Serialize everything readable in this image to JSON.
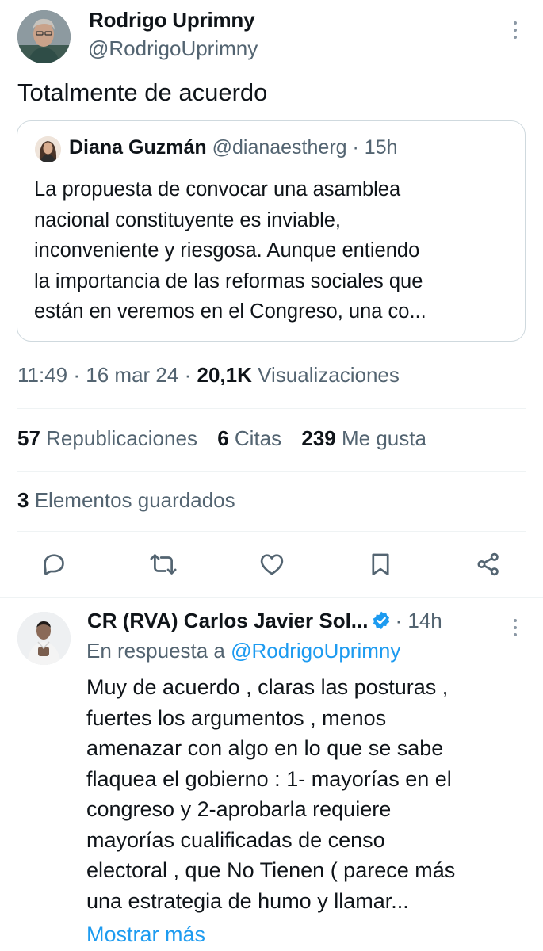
{
  "main_tweet": {
    "author_name": "Rodrigo Uprimny",
    "author_handle": "@RodrigoUprimny",
    "text": "Totalmente de acuerdo",
    "quote": {
      "author_name": "Diana Guzmán",
      "author_handle": "@dianaestherg",
      "separator": "·",
      "age": "15h",
      "lines": [
        "La propuesta de convocar una asamblea",
        "nacional constituyente es inviable,",
        "inconveniente y riesgosa. Aunque entiendo",
        "la importancia de las reformas sociales que",
        "están en veremos en el Congreso, una co..."
      ]
    },
    "meta": {
      "time": "11:49",
      "date": "16 mar 24",
      "separator": "·",
      "views_count": "20,1K",
      "views_label": "Visualizaciones"
    },
    "stats": {
      "reposts_count": "57",
      "reposts_label": "Republicaciones",
      "quotes_count": "6",
      "quotes_label": "Citas",
      "likes_count": "239",
      "likes_label": "Me gusta",
      "bookmarks_count": "3",
      "bookmarks_label": "Elementos guardados"
    },
    "actions": [
      "reply-icon",
      "repost-icon",
      "like-icon",
      "bookmark-icon",
      "share-icon"
    ]
  },
  "reply": {
    "author_name": "CR (RVA) Carlos Javier Sol...",
    "separator": "·",
    "age": "14h",
    "reply_prefix": "En respuesta a",
    "reply_mention": "@RodrigoUprimny",
    "lines": [
      "Muy de acuerdo , claras las posturas ,",
      "fuertes los argumentos , menos",
      "amenazar con algo en lo que se sabe",
      "flaquea el gobierno : 1- mayorías en el",
      "congreso y 2-aprobarla requiere",
      "mayorías cualificadas de censo",
      "electoral , que No Tienen ( parece más",
      "una estrategia de humo y llamar..."
    ],
    "show_more": "Mostrar más"
  },
  "colors": {
    "text_primary": "#0f1419",
    "text_secondary": "#536471",
    "accent": "#1d9bf0",
    "border": "#cfd9de",
    "divider": "#eff3f4"
  }
}
